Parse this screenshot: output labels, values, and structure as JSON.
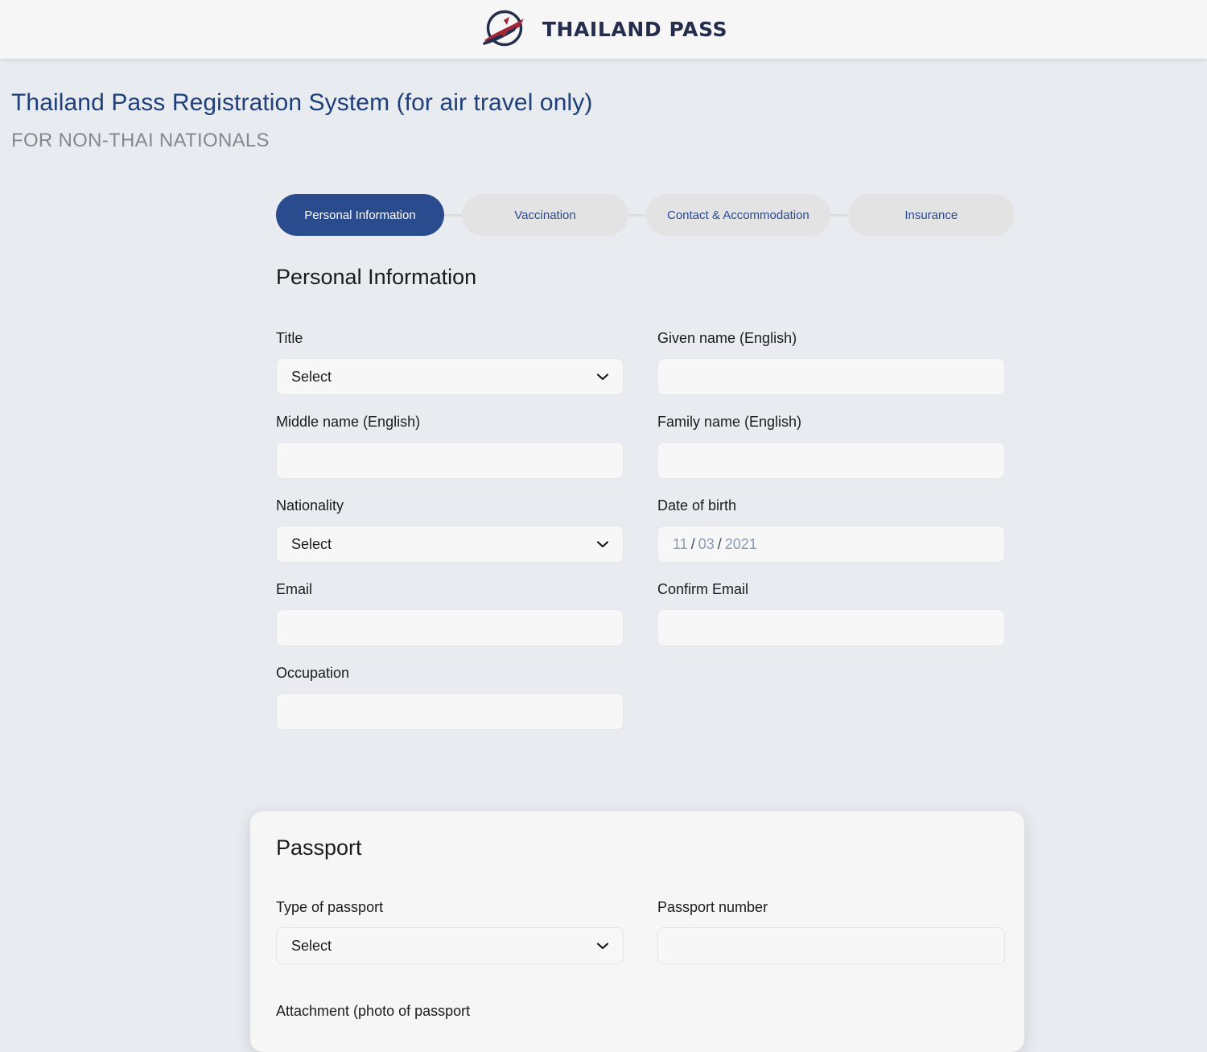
{
  "header": {
    "brand_name": "THAILAND PASS",
    "logo_icon": "airplane-globe-logo"
  },
  "page": {
    "title": "Thailand Pass Registration System (for air travel only)",
    "subtitle": "FOR NON-THAI NATIONALS"
  },
  "stepper": {
    "steps": [
      {
        "label": "Personal Information",
        "active": true
      },
      {
        "label": "Vaccination",
        "active": false
      },
      {
        "label": "Contact & Accommodation",
        "active": false
      },
      {
        "label": "Insurance",
        "active": false
      }
    ]
  },
  "personal_information": {
    "section_title": "Personal Information",
    "fields": {
      "title": {
        "label": "Title",
        "value": "Select",
        "type": "select"
      },
      "given_name": {
        "label": "Given name (English)",
        "value": "",
        "placeholder": ""
      },
      "middle_name": {
        "label": "Middle name (English)",
        "value": "",
        "placeholder": ""
      },
      "family_name": {
        "label": "Family name (English)",
        "value": "",
        "placeholder": ""
      },
      "nationality": {
        "label": "Nationality",
        "value": "Select",
        "type": "select"
      },
      "date_of_birth": {
        "label": "Date of birth",
        "day": "11",
        "month": "03",
        "year": "2021",
        "separator": "/"
      },
      "email": {
        "label": "Email",
        "value": "",
        "placeholder": ""
      },
      "confirm_email": {
        "label": "Confirm Email",
        "value": "",
        "placeholder": ""
      },
      "occupation": {
        "label": "Occupation",
        "value": "",
        "placeholder": ""
      }
    }
  },
  "passport": {
    "card_title": "Passport",
    "fields": {
      "type_of_passport": {
        "label": "Type of passport",
        "value": "Select",
        "type": "select"
      },
      "passport_number": {
        "label": "Passport number",
        "value": "",
        "placeholder": ""
      },
      "attachment": {
        "label": "Attachment (photo of passport"
      }
    }
  },
  "colors": {
    "page_background": "#e8ecf0",
    "header_background": "#f6f6f7",
    "primary_navy": "#2a4b8d",
    "title_blue": "#1f3f78",
    "subtitle_gray": "#85888c",
    "pill_inactive": "#e4e3e3",
    "input_background": "#f7f7f7",
    "input_border": "#e3e5e8",
    "logo_navy": "#252d4d",
    "logo_red": "#a32638",
    "date_text": "#8b9bb4"
  }
}
